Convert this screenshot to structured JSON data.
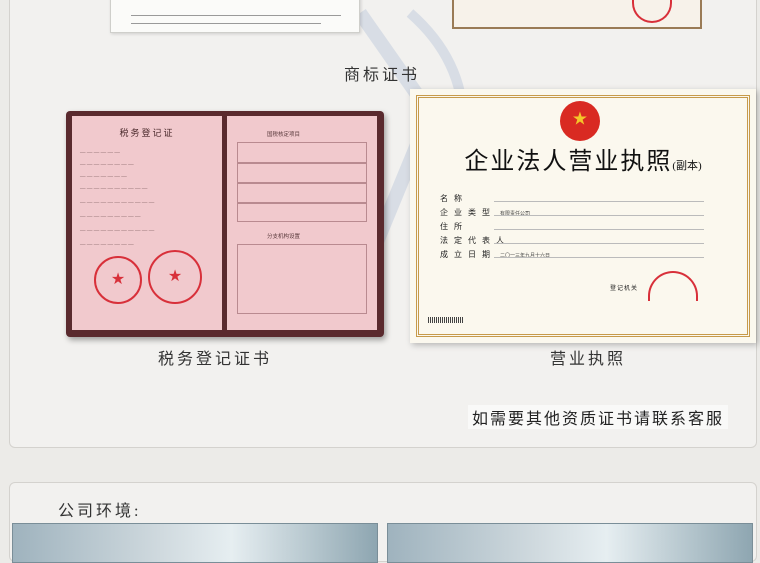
{
  "captions": {
    "trademark": "商标证书",
    "tax": "税务登记证书",
    "license": "营业执照"
  },
  "tax_certificate": {
    "title": "税务登记证",
    "right_title": "国税核定项目",
    "right_subtitle": "分支机构设置"
  },
  "business_license": {
    "title": "企业法人营业执照",
    "copy_mark": "(副本)",
    "fields": [
      {
        "label": "名称"
      },
      {
        "label": "企业类型",
        "value": "有限责任公司"
      },
      {
        "label": "住所"
      },
      {
        "label": "法定代表人"
      },
      {
        "label": "成立日期",
        "value": "二〇一三年九月十六日"
      }
    ],
    "registration_authority": "登记机关"
  },
  "contact_note": "如需要其他资质证书请联系客服",
  "environment": {
    "title": "公司环境:"
  },
  "colors": {
    "panel_bg": "#f2f1ef",
    "seal_red": "#d8303a",
    "tax_cover": "#5a2a2e",
    "tax_page": "#f1c9cd",
    "license_border": "#c79a4a"
  }
}
